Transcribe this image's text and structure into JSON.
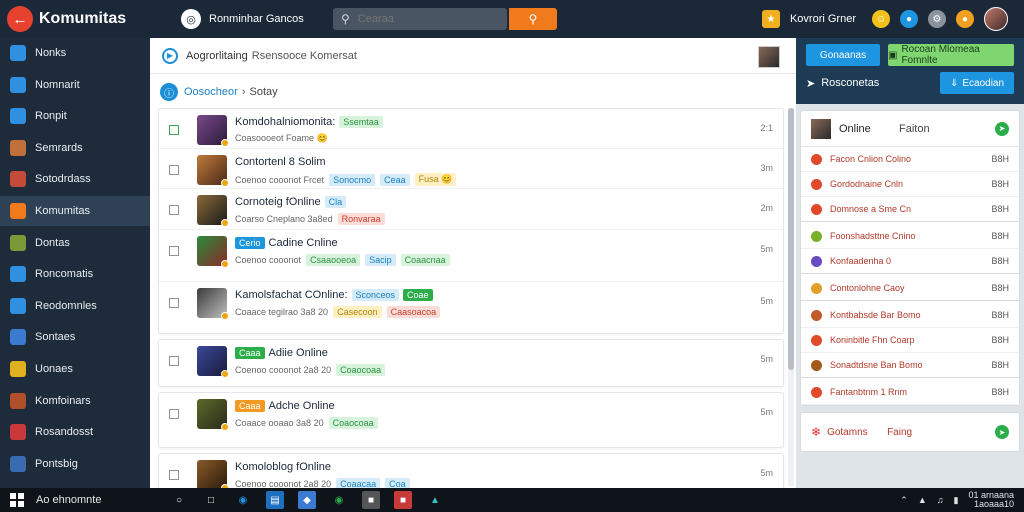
{
  "app": {
    "title": "Komumitas",
    "org_name": "Ronminhar Gancos"
  },
  "search": {
    "placeholder": "Cearaa",
    "value": ""
  },
  "topbar": {
    "user_name": "Kovrori Grner"
  },
  "sidebar": {
    "items": [
      {
        "label": "Nonks",
        "icon": "cube-icon",
        "color": "#2f8fe0"
      },
      {
        "label": "Nomnarit",
        "icon": "cube-icon",
        "color": "#2f8fe0"
      },
      {
        "label": "Ronpit",
        "icon": "cube-icon",
        "color": "#2f8fe0"
      },
      {
        "label": "Semrards",
        "icon": "game-icon",
        "color": "#c0703a"
      },
      {
        "label": "Sotodrdass",
        "icon": "game-icon",
        "color": "#c44a3a"
      },
      {
        "label": "Komumitas",
        "icon": "globe-icon",
        "color": "#f07a1c",
        "active": true
      },
      {
        "label": "Dontas",
        "icon": "game-icon",
        "color": "#7a9a3a"
      },
      {
        "label": "Roncomatis",
        "icon": "cube-icon",
        "color": "#2f8fe0"
      },
      {
        "label": "Reodomnles",
        "icon": "cube-icon",
        "color": "#2f8fe0"
      },
      {
        "label": "Sontaes",
        "icon": "cube-icon",
        "color": "#3a7ad0"
      },
      {
        "label": "Uonaes",
        "icon": "cube-icon",
        "color": "#e0b020"
      },
      {
        "label": "Komfoinars",
        "icon": "game-icon",
        "color": "#b0502a"
      },
      {
        "label": "Rosandosst",
        "icon": "game-icon",
        "color": "#c83a3a"
      },
      {
        "label": "Pontsbig",
        "icon": "globe-icon",
        "color": "#3a6ab0"
      }
    ]
  },
  "center": {
    "title": "Aogrorlitaing",
    "subtitle": "Rsensooce Komersat",
    "breadcrumb": {
      "parent": "Oosocheor",
      "current": "Sotay"
    }
  },
  "rows": [
    {
      "title": "Komdohalniomonita:",
      "tags": [
        {
          "text": "Ssemtaa",
          "cls": "green"
        }
      ],
      "sub": "Coasoooeot Foame 😊",
      "time": "2:1",
      "checked": true,
      "thumb": "linear-gradient(135deg,#7a4a8a,#2a1a3a)"
    },
    {
      "title": "Contortenl 8 Solim",
      "tags": [],
      "sub": "Coenoo cooonot Frcet",
      "subtags": [
        {
          "text": "Sonocmo",
          "cls": "blue"
        },
        {
          "text": "Ceaa",
          "cls": "blue"
        },
        {
          "text": "Fusa 😊",
          "cls": "yellow"
        }
      ],
      "time": "3m",
      "thumb": "linear-gradient(135deg,#c07a3a,#4a2a1a)"
    },
    {
      "title": "Cornoteig fOnline",
      "tags": [
        {
          "text": "Cla",
          "cls": "blue"
        }
      ],
      "sub": "Coarso Cneplano 3a8ed",
      "subtags": [
        {
          "text": "Ronvaraa",
          "cls": "red"
        }
      ],
      "time": "2m",
      "thumb": "linear-gradient(135deg,#8a6a3a,#1a1a1a)"
    }
  ],
  "group_rows": [
    {
      "title": "Cadine Cnline",
      "tag_lead": {
        "text": "Cerio",
        "cls": "solid-blue"
      },
      "sub": "Coenoo cooonot",
      "subtags": [
        {
          "text": "Csaaooeoa",
          "cls": "green"
        },
        {
          "text": "Sacip",
          "cls": "blue"
        },
        {
          "text": "Coaacnaa",
          "cls": "green"
        }
      ],
      "time": "5m",
      "thumb": "linear-gradient(135deg,#2a8a3a,#8a2a2a)"
    },
    {
      "title": "Kamolsfachat COnline:",
      "tags": [
        {
          "text": "Sconceos",
          "cls": "blue"
        },
        {
          "text": "Coae",
          "cls": "solid-green"
        }
      ],
      "sub": "Coaace tegilrao 3a8 20",
      "subtags": [
        {
          "text": "Casecoon",
          "cls": "yellow"
        },
        {
          "text": "Caasoacoa",
          "cls": "red"
        }
      ],
      "time": "5m",
      "thumb": "linear-gradient(135deg,#3a3a3a,#c0c0c0)"
    }
  ],
  "solo_rows": [
    {
      "title": "Adiie Online",
      "tag_lead": {
        "text": "Caaa",
        "cls": "solid-green"
      },
      "sub": "Coenoo cooonot 2a8 20",
      "subtags": [
        {
          "text": "Coaocoaa",
          "cls": "green"
        }
      ],
      "time": "5m",
      "thumb": "linear-gradient(135deg,#3a4a9a,#1a1a3a)"
    },
    {
      "title": "Adche Online",
      "tag_lead": {
        "text": "Caaa",
        "cls": "solid-orange"
      },
      "sub": "Coaace ooaao 3a8 20",
      "subtags": [
        {
          "text": "Coaocoaa",
          "cls": "green"
        }
      ],
      "time": "5m",
      "thumb": "linear-gradient(135deg,#5a6a2a,#2a2a1a)"
    },
    {
      "title": "Komoloblog fOnline",
      "tags": [],
      "sub": "Coenoo cooonot 2a8 20",
      "subtags": [
        {
          "text": "Coaacaa",
          "cls": "blue"
        },
        {
          "text": "Coa",
          "cls": "blue"
        }
      ],
      "time": "5m",
      "thumb": "linear-gradient(135deg,#8a5a2a,#2a1a0a)"
    }
  ],
  "right": {
    "btn1": "Gonaanas",
    "btn2": "Rocoan Mlomeaa Fomnlte",
    "label": "Rosconetas",
    "btn3": "Ecaodian",
    "panel_title": "Online",
    "panel_sub": "Faiton",
    "entries": [
      {
        "label": "Facon Cnlion Colino",
        "val": "B8H",
        "color": "#e04a2a"
      },
      {
        "label": "Gordodnaine Cnln",
        "val": "B8H",
        "color": "#e04a2a"
      },
      {
        "label": "Domnose a Sme Cn",
        "val": "B8H",
        "color": "#e04a2a"
      },
      {
        "label": "Foonshadsttne Cnino",
        "val": "B8H",
        "color": "#7ab02a"
      },
      {
        "label": "Konfaadenha 0",
        "val": "B8H",
        "color": "#6a4ac0"
      },
      {
        "label": "Contonlohne Caoy",
        "val": "B8H",
        "color": "#e0a02a"
      },
      {
        "label": "Kontbabsde Bar Bomo",
        "val": "B8H",
        "color": "#c05a2a"
      },
      {
        "label": "Koninbitle Fhn Coarp",
        "val": "B8H",
        "color": "#e04a2a"
      },
      {
        "label": "Sonadtdsne Ban Bomo",
        "val": "B8H",
        "color": "#a05a1a"
      },
      {
        "label": "Fantanbtnm 1 Rnm",
        "val": "B8H",
        "color": "#e04a2a"
      }
    ],
    "footer_a": "Gotamns",
    "footer_b": "Faing"
  },
  "taskbar": {
    "search": "Ao ehnomnte",
    "time": "01 arnaana",
    "date": "1aoaaa10"
  }
}
